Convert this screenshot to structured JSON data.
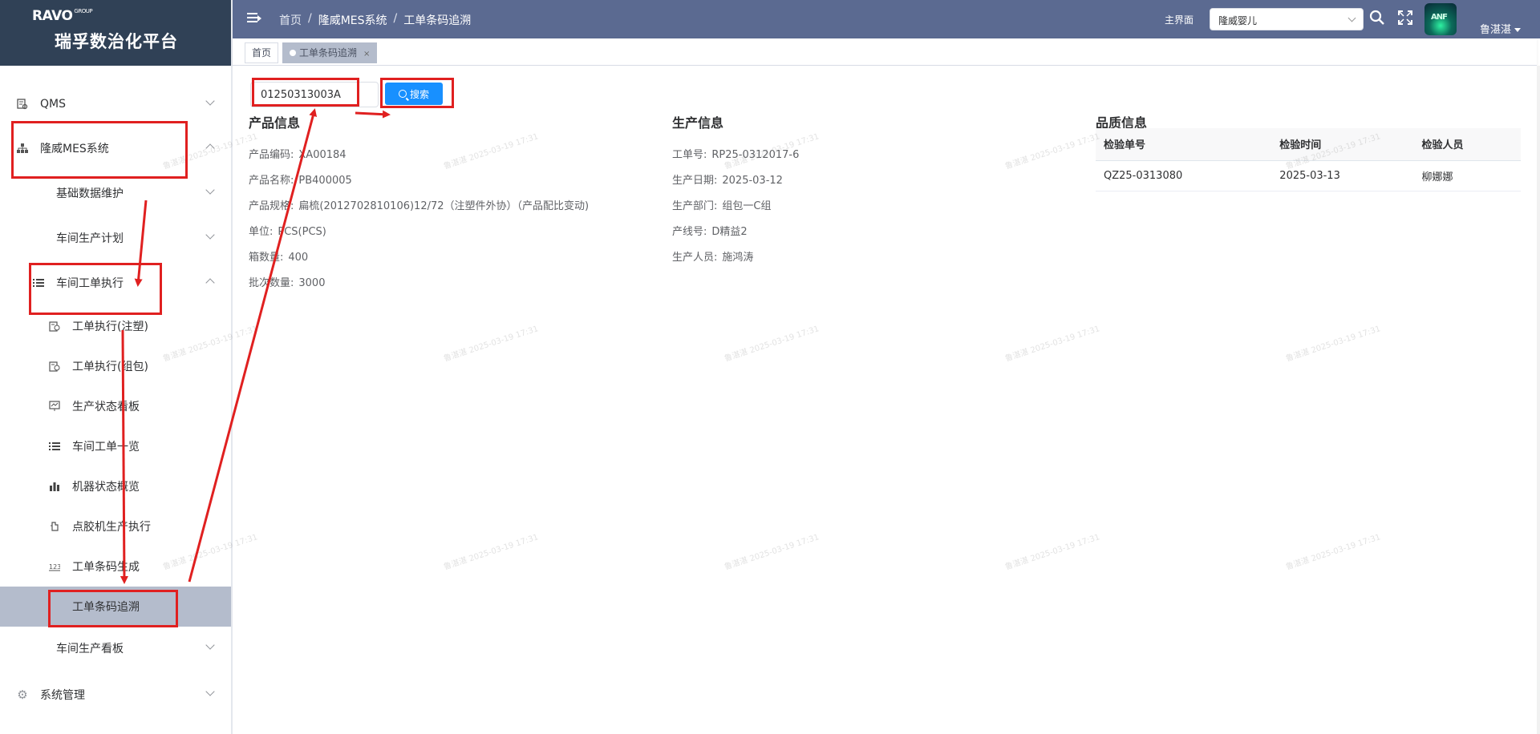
{
  "brand": {
    "logo": "RAVO",
    "logo_sup": "GROUP",
    "title": "瑞孚数治化平台"
  },
  "sidebar": {
    "items": [
      {
        "label": "QMS",
        "icon": "report-icon"
      },
      {
        "label": "隆威MES系统",
        "icon": "hierarchy-icon"
      },
      {
        "label": "基础数据维护"
      },
      {
        "label": "车间生产计划"
      },
      {
        "label": "车间工单执行",
        "icon": "list-icon"
      },
      {
        "label": "工单执行(注塑)",
        "icon": "clipboard-icon"
      },
      {
        "label": "工单执行(组包)",
        "icon": "clipboard-icon"
      },
      {
        "label": "生产状态看板",
        "icon": "monitor-icon"
      },
      {
        "label": "车间工单一览",
        "icon": "list-icon"
      },
      {
        "label": "机器状态概览",
        "icon": "bar-chart-icon"
      },
      {
        "label": "点胶机生产执行",
        "icon": "glue-icon"
      },
      {
        "label": "工单条码生成",
        "icon": "barcode-icon"
      },
      {
        "label": "工单条码追溯"
      },
      {
        "label": "车间生产看板"
      },
      {
        "label": "系统管理",
        "icon": "gear-icon"
      }
    ]
  },
  "header": {
    "breadcrumb": [
      "首页",
      "隆威MES系统",
      "工单条码追溯"
    ],
    "home_label": "主界面",
    "select_value": "隆威婴儿",
    "avatar_text": "ANF",
    "user": "鲁湛湛"
  },
  "tabs": [
    {
      "label": "首页"
    },
    {
      "label": "工单条码追溯",
      "close": "×"
    }
  ],
  "search": {
    "value": "01250313003A",
    "button": "搜索"
  },
  "product_info": {
    "title": "产品信息",
    "rows": [
      {
        "label": "产品编码:",
        "value": "XA00184"
      },
      {
        "label": "产品名称:",
        "value": "PB400005"
      },
      {
        "label": "产品规格:",
        "value": "扁梳(2012702810106)12/72（注塑件外协）（产品配比变动)"
      },
      {
        "label": "单位:",
        "value": "PCS(PCS)"
      },
      {
        "label": "箱数量:",
        "value": "400"
      },
      {
        "label": "批次数量:",
        "value": "3000"
      }
    ]
  },
  "production_info": {
    "title": "生产信息",
    "rows": [
      {
        "label": "工单号:",
        "value": "RP25-0312017-6"
      },
      {
        "label": "生产日期:",
        "value": "2025-03-12"
      },
      {
        "label": "生产部门:",
        "value": "组包一C组"
      },
      {
        "label": "产线号:",
        "value": "D精益2"
      },
      {
        "label": "生产人员:",
        "value": "施鸿涛"
      }
    ]
  },
  "quality_info": {
    "title": "品质信息",
    "columns": [
      "检验单号",
      "检验时间",
      "检验人员"
    ],
    "rows": [
      [
        "QZ25-0313080",
        "2025-03-13",
        "柳娜娜"
      ]
    ]
  },
  "watermark": "鲁湛湛 2025-03-19 17:31",
  "colors": {
    "header": "#5b6a91",
    "brand": "#304156",
    "primary": "#1890ff",
    "annotation": "#e02020",
    "active_menu": "#b4bccc"
  }
}
